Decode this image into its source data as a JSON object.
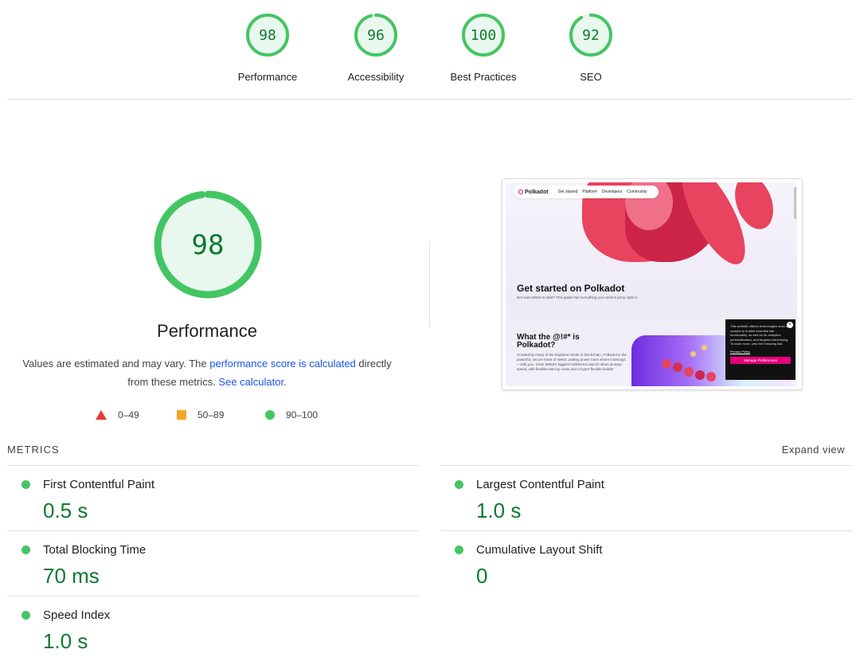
{
  "categories": [
    {
      "score": "98",
      "label": "Performance",
      "fraction": 0.98
    },
    {
      "score": "96",
      "label": "Accessibility",
      "fraction": 0.96
    },
    {
      "score": "100",
      "label": "Best Practices",
      "fraction": 1.0
    },
    {
      "score": "92",
      "label": "SEO",
      "fraction": 0.92
    }
  ],
  "main": {
    "score": "98",
    "fraction": 0.98,
    "title": "Performance",
    "desc_prefix": "Values are estimated and may vary. The ",
    "desc_link": "performance score is calculated",
    "desc_middle": " directly from these metrics. ",
    "desc_calc_link": "See calculator.",
    "legend": [
      {
        "range": "0–49",
        "shape": "triangle",
        "color": "#e53935"
      },
      {
        "range": "50–89",
        "shape": "square",
        "color": "#f5a623"
      },
      {
        "range": "90–100",
        "shape": "circle",
        "color": "#44c564"
      }
    ]
  },
  "screenshot": {
    "nav_logo": "Polkadot",
    "nav_items": [
      "Get started",
      "Platform",
      "Developers",
      "Community"
    ],
    "heading": "Get started on Polkadot",
    "subtext": "Not sure where to start? This guide has everything you need to jump right in.",
    "heading2": "What the @!#* is Polkadot?",
    "body": "Created by many of the brightest minds in blockchain, Polkadot is the powerful, secure heart of Web3, putting power back where it belongs—with you. It lets Web3's biggest trailblazers launch ideas at warp speed, with flexible start-up costs and a hyper-flexible builder",
    "popup_text": "This website utilizes technologies such as cookies to enable essential site functionality, as well as for analytics, personalization, and targeted advertising. To learn more, view the following link:",
    "popup_link": "Privacy Policy",
    "popup_button": "Manage Preferences"
  },
  "metrics": {
    "heading": "METRICS",
    "expand_label": "Expand view",
    "items": [
      {
        "name": "First Contentful Paint",
        "value": "0.5 s"
      },
      {
        "name": "Largest Contentful Paint",
        "value": "1.0 s"
      },
      {
        "name": "Total Blocking Time",
        "value": "70 ms"
      },
      {
        "name": "Cumulative Layout Shift",
        "value": "0"
      },
      {
        "name": "Speed Index",
        "value": "1.0 s"
      }
    ]
  },
  "colors": {
    "pass_green": "#44c564",
    "pass_text": "#0c7a2e",
    "gauge_track": "#e5f7ea",
    "link_blue": "#1a55e8",
    "brand_pink": "#e6007a"
  }
}
